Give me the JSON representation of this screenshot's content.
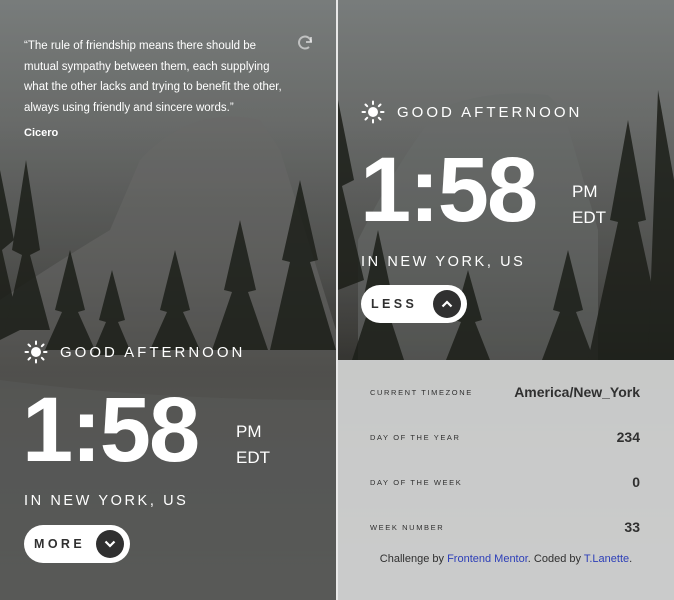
{
  "quote": {
    "text": "“The rule of friendship means there should be mutual sympathy between them, each supplying what the other lacks and trying to benefit the other, always using friendly and sincere words.”",
    "author": "Cicero",
    "refresh_icon": "refresh-icon"
  },
  "clock_collapsed": {
    "greeting": "GOOD AFTERNOON",
    "greeting_icon": "sun-icon",
    "time": "1:58",
    "meridiem": "PM",
    "timezone_abbr": "EDT",
    "location": "IN NEW YORK, US",
    "toggle_label": "MORE",
    "toggle_icon": "chevron-down-icon"
  },
  "clock_expanded": {
    "greeting": "GOOD AFTERNOON",
    "greeting_icon": "sun-icon",
    "time": "1:58",
    "meridiem": "PM",
    "timezone_abbr": "EDT",
    "location": "IN NEW YORK, US",
    "toggle_label": "LESS",
    "toggle_icon": "chevron-up-icon"
  },
  "details": {
    "rows": [
      {
        "label": "CURRENT TIMEZONE",
        "value": "America/New_York"
      },
      {
        "label": "DAY OF THE YEAR",
        "value": "234"
      },
      {
        "label": "DAY OF THE WEEK",
        "value": "0"
      },
      {
        "label": "WEEK NUMBER",
        "value": "33"
      }
    ],
    "credit_prefix": "Challenge by ",
    "credit_link1": "Frontend Mentor",
    "credit_middle": ". Coded by ",
    "credit_link2": "T.Lanette",
    "credit_suffix": "."
  },
  "colors": {
    "text_dark": "#303030",
    "link": "#2d3fb8",
    "panel_bg": "#e1e2e2"
  }
}
